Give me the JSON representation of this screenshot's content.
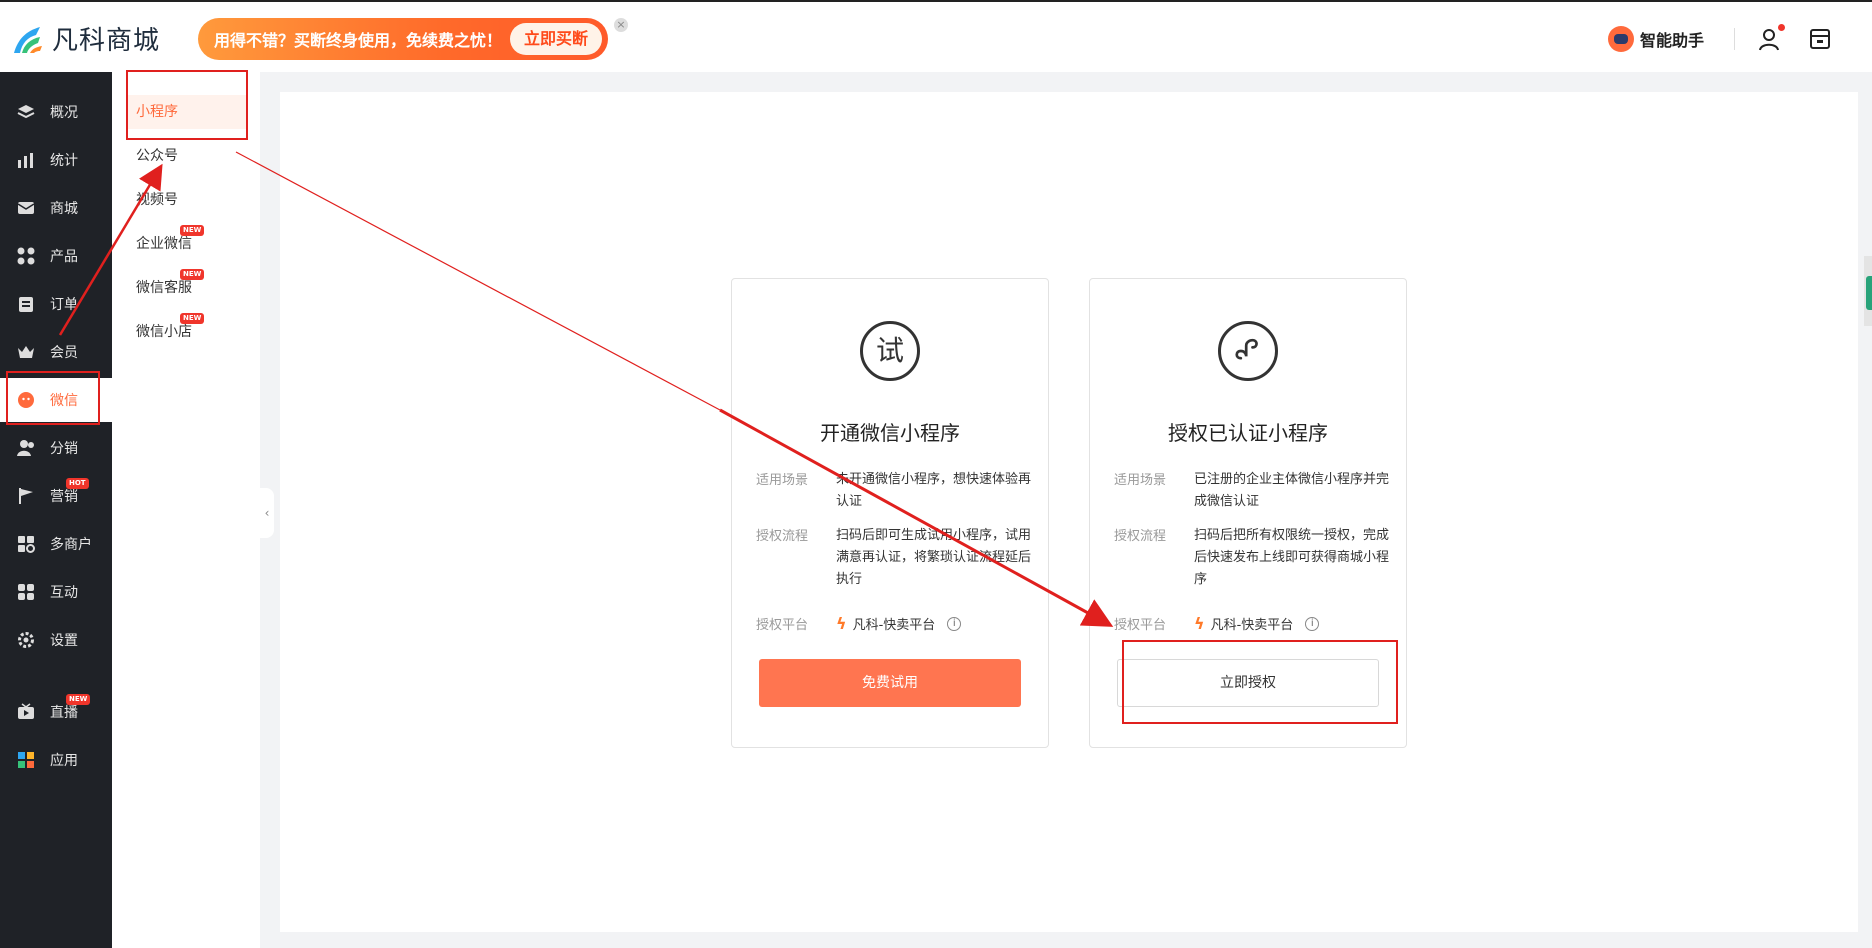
{
  "header": {
    "brand": "凡科商城",
    "promo_text": "用得不错？买断终身使用，免续费之忧！",
    "promo_button": "立即买断",
    "assistant_label": "智能助手"
  },
  "sidebar": {
    "items": [
      {
        "label": "概况",
        "icon": "layers-icon"
      },
      {
        "label": "统计",
        "icon": "chart-icon"
      },
      {
        "label": "商城",
        "icon": "mail-icon"
      },
      {
        "label": "产品",
        "icon": "grid-icon"
      },
      {
        "label": "订单",
        "icon": "clipboard-icon"
      },
      {
        "label": "会员",
        "icon": "crown-icon"
      },
      {
        "label": "微信",
        "icon": "wechat-icon"
      },
      {
        "label": "分销",
        "icon": "users-icon"
      },
      {
        "label": "营销",
        "icon": "flag-icon",
        "badge": "HOT"
      },
      {
        "label": "多商户",
        "icon": "store-grid-icon"
      },
      {
        "label": "互动",
        "icon": "apps-icon"
      },
      {
        "label": "设置",
        "icon": "gear-icon"
      },
      {
        "label": "直播",
        "icon": "tv-icon",
        "badge": "NEW"
      },
      {
        "label": "应用",
        "icon": "app-blocks-icon"
      }
    ]
  },
  "subbar": {
    "items": [
      {
        "label": "小程序"
      },
      {
        "label": "公众号"
      },
      {
        "label": "视频号"
      },
      {
        "label": "企业微信",
        "badge": "NEW"
      },
      {
        "label": "微信客服",
        "badge": "NEW"
      },
      {
        "label": "微信小店",
        "badge": "NEW"
      }
    ]
  },
  "cards": [
    {
      "icon_char": "试",
      "title": "开通微信小程序",
      "scene_label": "适用场景",
      "scene_text": "未开通微信小程序，想快速体验再认证",
      "flow_label": "授权流程",
      "flow_text": "扫码后即可生成试用小程序，试用满意再认证，将繁琐认证流程延后执行",
      "platform_label": "授权平台",
      "platform_text": "凡科-快卖平台",
      "button": "免费试用"
    },
    {
      "icon_char": "",
      "title": "授权已认证小程序",
      "scene_label": "适用场景",
      "scene_text": "已注册的企业主体微信小程序并完成微信认证",
      "flow_label": "授权流程",
      "flow_text": "扫码后把所有权限统一授权，完成后快速发布上线即可获得商城小程序",
      "platform_label": "授权平台",
      "platform_text": "凡科-快卖平台",
      "button": "立即授权"
    }
  ],
  "colors": {
    "accent": "#ff6a3c",
    "sidebar_bg": "#1f2227",
    "annotation": "#e0201e"
  }
}
